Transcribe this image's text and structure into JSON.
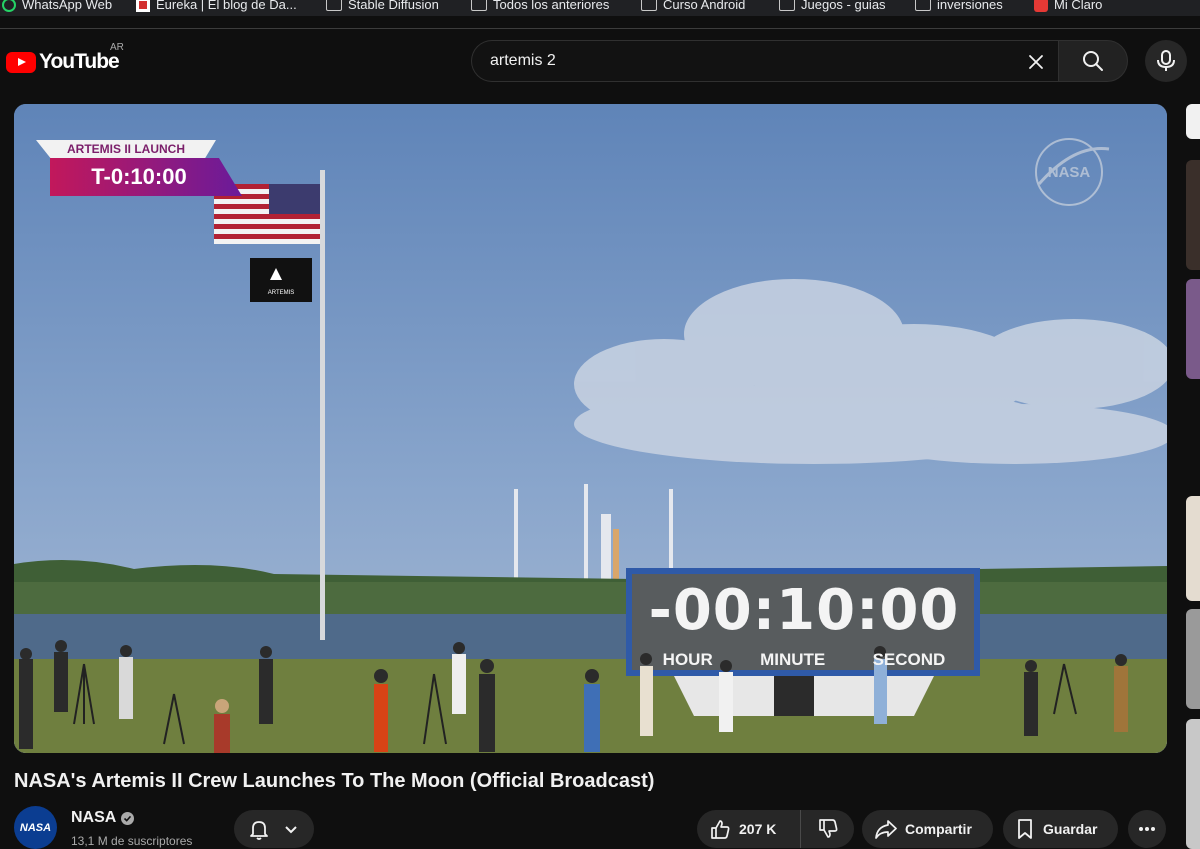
{
  "bookmarks": [
    {
      "label": "WhatsApp Web",
      "icon": "whatsapp-icon"
    },
    {
      "label": "Eureka | El blog de Da...",
      "icon": "eureka-icon"
    },
    {
      "label": "Stable Diffusion",
      "icon": "folder-icon"
    },
    {
      "label": "Todos los anteriores",
      "icon": "folder-icon"
    },
    {
      "label": "Curso Android",
      "icon": "folder-icon"
    },
    {
      "label": "Juegos - guias",
      "icon": "folder-icon"
    },
    {
      "label": "inversiones",
      "icon": "folder-icon"
    },
    {
      "label": "Mi Claro",
      "icon": "claro-icon"
    }
  ],
  "masthead": {
    "logo_text": "YouTube",
    "country_code": "AR",
    "search_value": "artemis 2"
  },
  "video": {
    "overlay_title": "ARTEMIS II LAUNCH",
    "overlay_countdown": "T-0:10:00",
    "board_countdown": "-00:10:00",
    "board_labels": [
      "HOUR",
      "MINUTE",
      "SECOND"
    ],
    "watermark": "NASA",
    "flag_text": "ARTEMIS",
    "title": "NASA's Artemis II Crew Launches To The Moon (Official Broadcast)"
  },
  "channel": {
    "name": "NASA",
    "subscribers": "13,1 M de suscriptores",
    "avatar_text": "NASA"
  },
  "actions": {
    "likes": "207 K",
    "share_label": "Compartir",
    "save_label": "Guardar"
  },
  "colors": {
    "youtube_red": "#ff0000",
    "background": "#0f0f0f",
    "pill": "#272727",
    "overlay_magenta": "#c2185b",
    "nasa_blue": "#0b3d91"
  }
}
